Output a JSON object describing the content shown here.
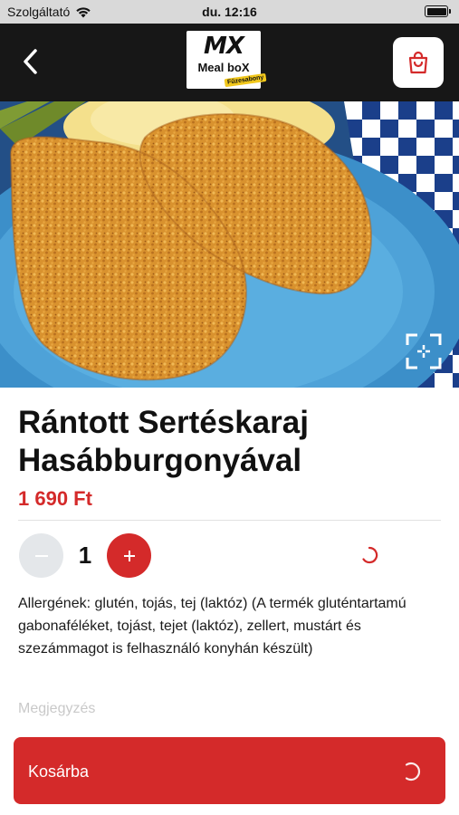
{
  "status_bar": {
    "carrier": "Szolgáltató",
    "time": "du. 12:16"
  },
  "header": {
    "logo": {
      "brand": "MX",
      "name": "Meal boX",
      "tag": "Fűzesabony"
    },
    "back_icon": "chevron-left-icon",
    "cart_icon": "shopping-bag-icon"
  },
  "product": {
    "title": "Rántott Sertéskaraj Hasábburgonyával",
    "price": "1 690 Ft",
    "quantity": "1",
    "minus_label": "−",
    "plus_label": "+",
    "allergens": "Allergének: glutén, tojás, tej (laktóz) (A termék gluténtartamú gabonaféléket, tojást, tejet (laktóz), zellert, mustárt és szezámmagot is felhasználó konyhán készült)",
    "note_placeholder": "Megjegyzés"
  },
  "add_to_cart": {
    "label": "Kosárba"
  },
  "colors": {
    "accent": "#d42a2a",
    "header_bg": "#171717",
    "minus_bg": "#e4e7ea"
  }
}
